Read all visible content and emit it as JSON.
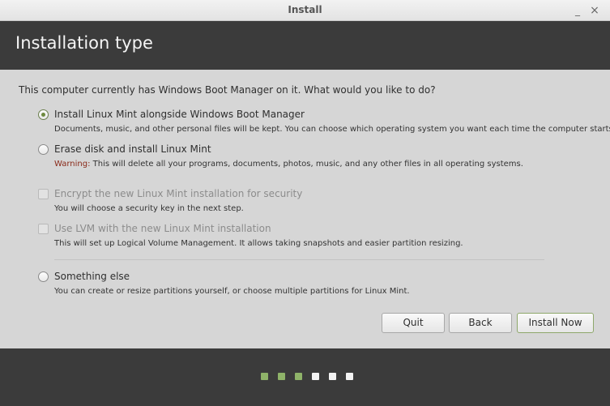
{
  "window": {
    "title": "Install",
    "minimize_glyph": "_",
    "close_glyph": "×"
  },
  "header": {
    "title": "Installation type"
  },
  "question": "This computer currently has Windows Boot Manager on it. What would you like to do?",
  "options": [
    {
      "label": "Install Linux Mint alongside Windows Boot Manager",
      "description": "Documents, music, and other personal files will be kept. You can choose which operating system you want each time the computer starts up.",
      "type": "radio",
      "checked": true
    },
    {
      "label": "Erase disk and install Linux Mint",
      "warning_prefix": "Warning:",
      "description": " This will delete all your programs, documents, photos, music, and any other files in all operating systems.",
      "type": "radio",
      "checked": false
    },
    {
      "label": "Encrypt the new Linux Mint installation for security",
      "description": "You will choose a security key in the next step.",
      "type": "checkbox",
      "checked": false,
      "disabled": true
    },
    {
      "label": "Use LVM with the new Linux Mint installation",
      "description": "This will set up Logical Volume Management. It allows taking snapshots and easier partition resizing.",
      "type": "checkbox",
      "checked": false,
      "disabled": true
    },
    {
      "label": "Something else",
      "description": "You can create or resize partitions yourself, or choose multiple partitions for Linux Mint.",
      "type": "radio",
      "checked": false
    }
  ],
  "buttons": {
    "quit": "Quit",
    "back": "Back",
    "install_now": "Install Now"
  },
  "progress": {
    "total_steps": 6,
    "completed_steps": 3,
    "completed_color": "#8fb369",
    "pending_color": "#f2f2f2"
  }
}
